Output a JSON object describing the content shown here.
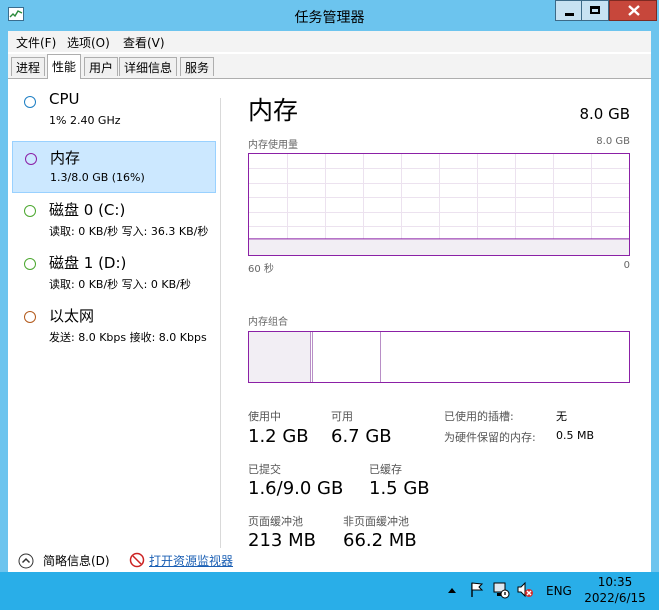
{
  "window": {
    "title": "任务管理器"
  },
  "menu": [
    "文件(F)",
    "选项(O)",
    "查看(V)"
  ],
  "tabs": [
    "进程",
    "性能",
    "用户",
    "详细信息",
    "服务"
  ],
  "active_tab": "性能",
  "sidebar": [
    {
      "name": "CPU",
      "sub": "1% 2.40 GHz",
      "color": "#1e7fc4"
    },
    {
      "name": "内存",
      "sub": "1.3/8.0 GB (16%)",
      "color": "#8b20a6"
    },
    {
      "name": "磁盘 0 (C:)",
      "sub": "读取: 0 KB/秒 写入: 36.3 KB/秒",
      "color": "#4ca830"
    },
    {
      "name": "磁盘 1 (D:)",
      "sub": "读取: 0 KB/秒 写入: 0 KB/秒",
      "color": "#4ca830"
    },
    {
      "name": "以太网",
      "sub": "发送: 8.0 Kbps 接收: 8.0 Kbps",
      "color": "#b35a1c"
    }
  ],
  "detail": {
    "title": "内存",
    "total": "8.0 GB",
    "usage_label": "内存使用量",
    "usage_max": "8.0 GB",
    "time_left": "60 秒",
    "time_right": "0",
    "usage_fraction": 0.16,
    "composition_label": "内存组合",
    "stats": {
      "in_use_label": "使用中",
      "in_use": "1.2 GB",
      "available_label": "可用",
      "available": "6.7 GB",
      "committed_label": "已提交",
      "committed": "1.6/9.0 GB",
      "cached_label": "已缓存",
      "cached": "1.5 GB",
      "paged_label": "页面缓冲池",
      "paged": "213 MB",
      "nonpaged_label": "非页面缓冲池",
      "nonpaged": "66.2 MB"
    },
    "right_stats": {
      "slots_label": "已使用的插槽:",
      "slots": "无",
      "reserved_label": "为硬件保留的内存:",
      "reserved": "0.5 MB"
    }
  },
  "footer": {
    "summary": "简略信息(D)",
    "resmon": "打开资源监视器"
  },
  "taskbar": {
    "lang": "ENG",
    "time": "10:35",
    "date": "2022/6/15"
  },
  "colors": {
    "memory": "#8b20a6",
    "taskbar": "#29aee8",
    "selected": "#cce8ff"
  }
}
